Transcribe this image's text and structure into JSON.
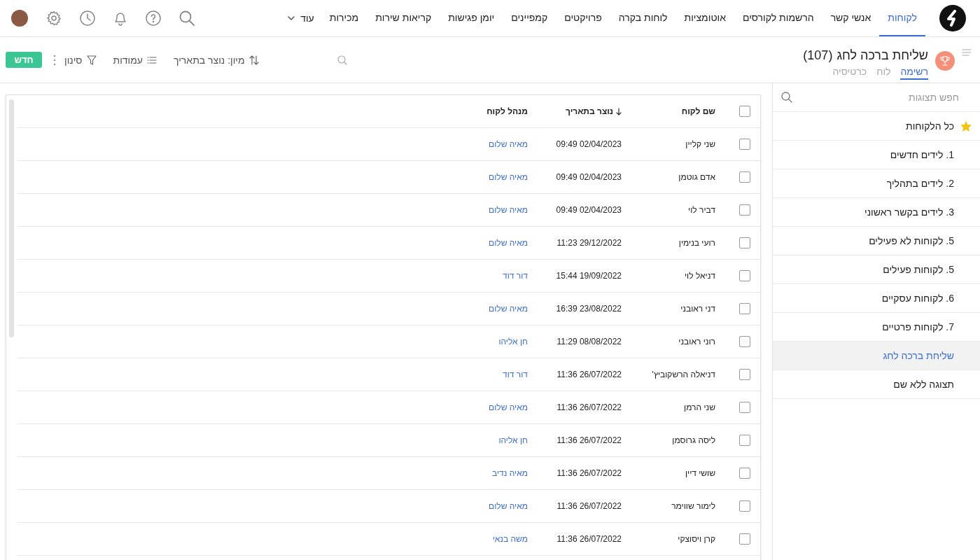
{
  "nav": {
    "items": [
      {
        "label": "לקוחות",
        "selected": true
      },
      {
        "label": "אנשי קשר",
        "selected": false
      },
      {
        "label": "הרשמות לקורסים",
        "selected": false
      },
      {
        "label": "אוטומציות",
        "selected": false
      },
      {
        "label": "לוחות בקרה",
        "selected": false
      },
      {
        "label": "פרויקטים",
        "selected": false
      },
      {
        "label": "קמפיינים",
        "selected": false
      },
      {
        "label": "יומן פגישות",
        "selected": false
      },
      {
        "label": "קריאות שירות",
        "selected": false
      },
      {
        "label": "מכירות",
        "selected": false
      }
    ],
    "more": "עוד"
  },
  "header": {
    "title": "שליחת ברכה לחג",
    "count": "(107)",
    "view_tabs": [
      {
        "label": "רשימה",
        "selected": true
      },
      {
        "label": "לוח",
        "selected": false
      },
      {
        "label": "כרטיסיה",
        "selected": false
      }
    ]
  },
  "toolbar": {
    "sort_label": "מיון: נוצר בתאריך",
    "columns_label": "עמודות",
    "filter_label": "סינון",
    "new_button": "חדש"
  },
  "sidebar": {
    "search": {
      "placeholder": "חפש תצוגות"
    },
    "items": [
      {
        "label": "כל הלקוחות",
        "selected": false,
        "starred": true
      },
      {
        "label": "1. לידים חדשים",
        "selected": false,
        "starred": false
      },
      {
        "label": "2. לידים בתהליך",
        "selected": false,
        "starred": false
      },
      {
        "label": "3. לידים בקשר ראשוני",
        "selected": false,
        "starred": false
      },
      {
        "label": "5. לקוחות לא פעילים",
        "selected": false,
        "starred": false
      },
      {
        "label": "5. לקוחות פעילים",
        "selected": false,
        "starred": false
      },
      {
        "label": "6. לקוחות עסקיים",
        "selected": false,
        "starred": false
      },
      {
        "label": "7. לקוחות פרטיים",
        "selected": false,
        "starred": false
      },
      {
        "label": "שליחת ברכה לחג",
        "selected": true,
        "starred": false
      },
      {
        "label": "תצוגה ללא שם",
        "selected": false,
        "starred": false
      }
    ]
  },
  "table": {
    "select_all_checked": false,
    "columns": [
      {
        "label": "שם לקוח",
        "sorted": false
      },
      {
        "label": "נוצר בתאריך",
        "sorted": true
      },
      {
        "label": "מנהל לקוח",
        "sorted": false
      }
    ],
    "rows": [
      {
        "checked": false,
        "name": "שני קליין",
        "created": "02/04/2023 09:49",
        "manager": "מאיה שלום"
      },
      {
        "checked": false,
        "name": "אדם גוטמן",
        "created": "02/04/2023 09:49",
        "manager": "מאיה שלום"
      },
      {
        "checked": false,
        "name": "דביר לוי",
        "created": "02/04/2023 09:49",
        "manager": "מאיה שלום"
      },
      {
        "checked": false,
        "name": "רועי בנימין",
        "created": "29/12/2022 11:23",
        "manager": "מאיה שלום"
      },
      {
        "checked": false,
        "name": "דניאל לוי",
        "created": "19/09/2022 15:44",
        "manager": "דור דוד"
      },
      {
        "checked": false,
        "name": "דני ראובני",
        "created": "23/08/2022 16:39",
        "manager": "מאיה שלום"
      },
      {
        "checked": false,
        "name": "רוני ראובני",
        "created": "08/08/2022 11:29",
        "manager": "חן אליהו"
      },
      {
        "checked": false,
        "name": "דניאלה הרשקוביץ'",
        "created": "26/07/2022 11:36",
        "manager": "דור דוד"
      },
      {
        "checked": false,
        "name": "שני הרמן",
        "created": "26/07/2022 11:36",
        "manager": "מאיה שלום"
      },
      {
        "checked": false,
        "name": "ליסה גרוסמן",
        "created": "26/07/2022 11:36",
        "manager": "חן אליהו"
      },
      {
        "checked": false,
        "name": "שושי דיין",
        "created": "26/07/2022 11:36",
        "manager": "מאיה נדיב"
      },
      {
        "checked": false,
        "name": "לימור שווימר",
        "created": "26/07/2022 11:36",
        "manager": "מאיה שלום"
      },
      {
        "checked": false,
        "name": "קרן ויסוצקי",
        "created": "26/07/2022 11:36",
        "manager": "משה בנאי"
      }
    ]
  }
}
